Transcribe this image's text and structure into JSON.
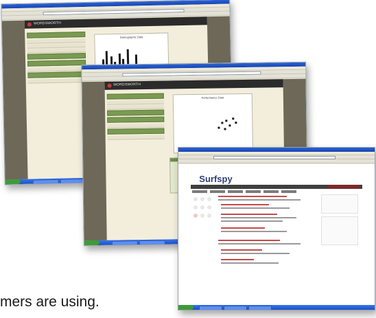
{
  "caption": "mers are using.",
  "screens": [
    {
      "id": "screen-1",
      "brand": "WORDSWORTH",
      "chart_title": "Demographic Data"
    },
    {
      "id": "screen-2",
      "brand": "WORDSWORTH",
      "chart_title": "Performance Data"
    },
    {
      "id": "screen-3",
      "brand": "Surfspy"
    }
  ],
  "colors": {
    "xp_titlebar": "#1745b4",
    "taskbar": "#1c4fc6",
    "start_button": "#3e9b38",
    "site_header": "#2b2b2b",
    "sidebar_tab": "#7a9a52",
    "accent_red": "#c23b3b",
    "surfspy_logo": "#2d3e74"
  }
}
